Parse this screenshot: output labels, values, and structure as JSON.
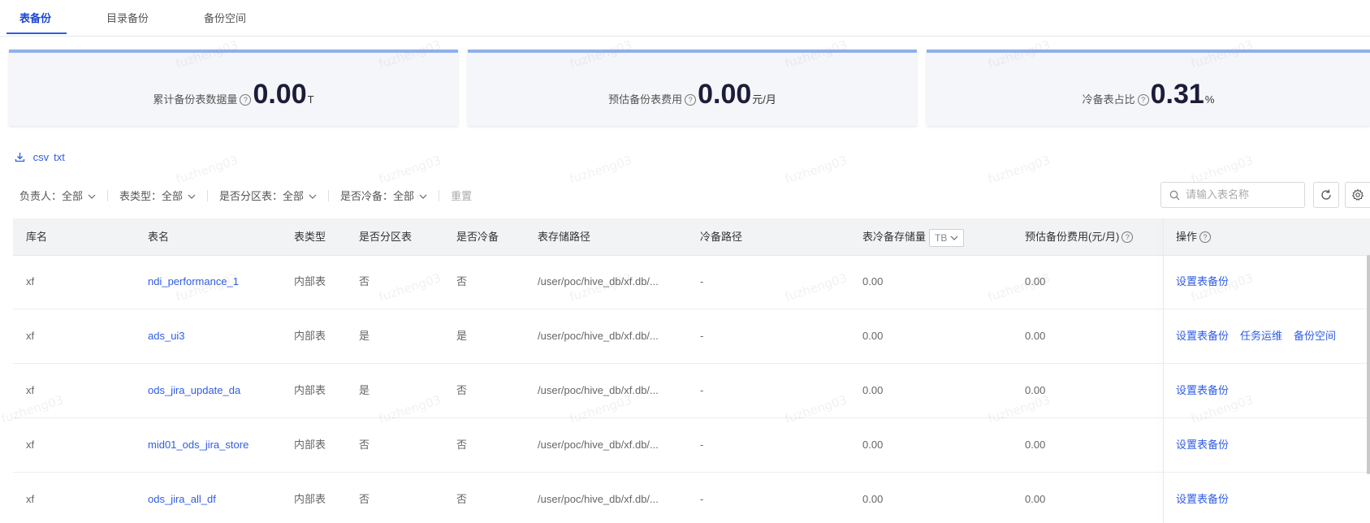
{
  "tabs": [
    {
      "label": "表备份"
    },
    {
      "label": "目录备份"
    },
    {
      "label": "备份空间"
    }
  ],
  "watermark": "fuzheng03",
  "stats": [
    {
      "label": "累计备份表数据量",
      "value": "0.00",
      "unit": "T"
    },
    {
      "label": "预估备份表费用",
      "value": "0.00",
      "unit": "元/月"
    },
    {
      "label": "冷备表占比",
      "value": "0.31",
      "unit": "%"
    }
  ],
  "export": {
    "csv": "csv",
    "txt": "txt"
  },
  "filters": [
    {
      "label": "负责人：全部"
    },
    {
      "label": "表类型：全部"
    },
    {
      "label": "是否分区表：全部"
    },
    {
      "label": "是否冷备：全部"
    }
  ],
  "reset_label": "重置",
  "search": {
    "placeholder": "请输入表名称"
  },
  "columns": {
    "db": "库名",
    "table": "表名",
    "type": "表类型",
    "partitioned": "是否分区表",
    "cold": "是否冷备",
    "path": "表存储路径",
    "cold_path": "冷备路径",
    "cold_size": "表冷备存储量",
    "cold_size_unit": "TB",
    "cost": "预估备份费用(元/月)",
    "ops": "操作"
  },
  "rows": [
    {
      "db": "xf",
      "table": "ndi_performance_1",
      "type": "内部表",
      "partitioned": "否",
      "cold": "否",
      "path": "/user/poc/hive_db/xf.db/...",
      "cold_path": "-",
      "cold_size": "0.00",
      "cost": "0.00",
      "ops": [
        "设置表备份"
      ]
    },
    {
      "db": "xf",
      "table": "ads_ui3",
      "type": "内部表",
      "partitioned": "是",
      "cold": "是",
      "path": "/user/poc/hive_db/xf.db/...",
      "cold_path": "-",
      "cold_size": "0.00",
      "cost": "0.00",
      "ops": [
        "设置表备份",
        "任务运维",
        "备份空间"
      ]
    },
    {
      "db": "xf",
      "table": "ods_jira_update_da",
      "type": "内部表",
      "partitioned": "是",
      "cold": "否",
      "path": "/user/poc/hive_db/xf.db/...",
      "cold_path": "-",
      "cold_size": "0.00",
      "cost": "0.00",
      "ops": [
        "设置表备份"
      ]
    },
    {
      "db": "xf",
      "table": "mid01_ods_jira_store",
      "type": "内部表",
      "partitioned": "否",
      "cold": "否",
      "path": "/user/poc/hive_db/xf.db/...",
      "cold_path": "-",
      "cold_size": "0.00",
      "cost": "0.00",
      "ops": [
        "设置表备份"
      ]
    },
    {
      "db": "xf",
      "table": "ods_jira_all_df",
      "type": "内部表",
      "partitioned": "否",
      "cold": "否",
      "path": "/user/poc/hive_db/xf.db/...",
      "cold_path": "-",
      "cold_size": "0.00",
      "cost": "0.00",
      "ops": [
        "设置表备份"
      ]
    }
  ]
}
